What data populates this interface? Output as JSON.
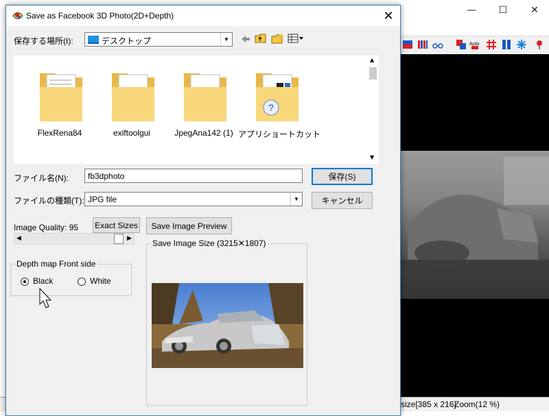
{
  "background_app": {
    "window_controls": [
      "—",
      "☐",
      "✕"
    ],
    "status_bar": {
      "size_text": "size[385 x 216]",
      "zoom_text": "Zoom(12 %)"
    }
  },
  "dialog": {
    "title": "Save as Facebook 3D Photo(2D+Depth)",
    "save_in_label": "保存する場所(I):",
    "save_in_value": "デスクトップ",
    "files": [
      {
        "name": "FlexRena84",
        "icon": "folder-icon"
      },
      {
        "name": "exiftoolgui",
        "icon": "folder-icon"
      },
      {
        "name": "JpegAna142 (1)",
        "icon": "folder-icon"
      },
      {
        "name": "アプリショートカット",
        "icon": "folder-icon"
      }
    ],
    "filename_label": "ファイル名(N):",
    "filename_value": "fb3dphoto",
    "filetype_label": "ファイルの種類(T):",
    "filetype_value": "JPG file",
    "save_button": "保存(S)",
    "cancel_button": "キャンセル",
    "image_quality_label": "Image Quality:",
    "image_quality_value": "95",
    "exact_sizes_button": "Exact Sizes",
    "save_preview_button": "Save Image Preview",
    "save_size_label": "Save Image Size (3215✕1807)",
    "depth_group_title": "Depth map Front side",
    "radio_black": "Black",
    "radio_white": "White",
    "selected_depth": "Black"
  }
}
